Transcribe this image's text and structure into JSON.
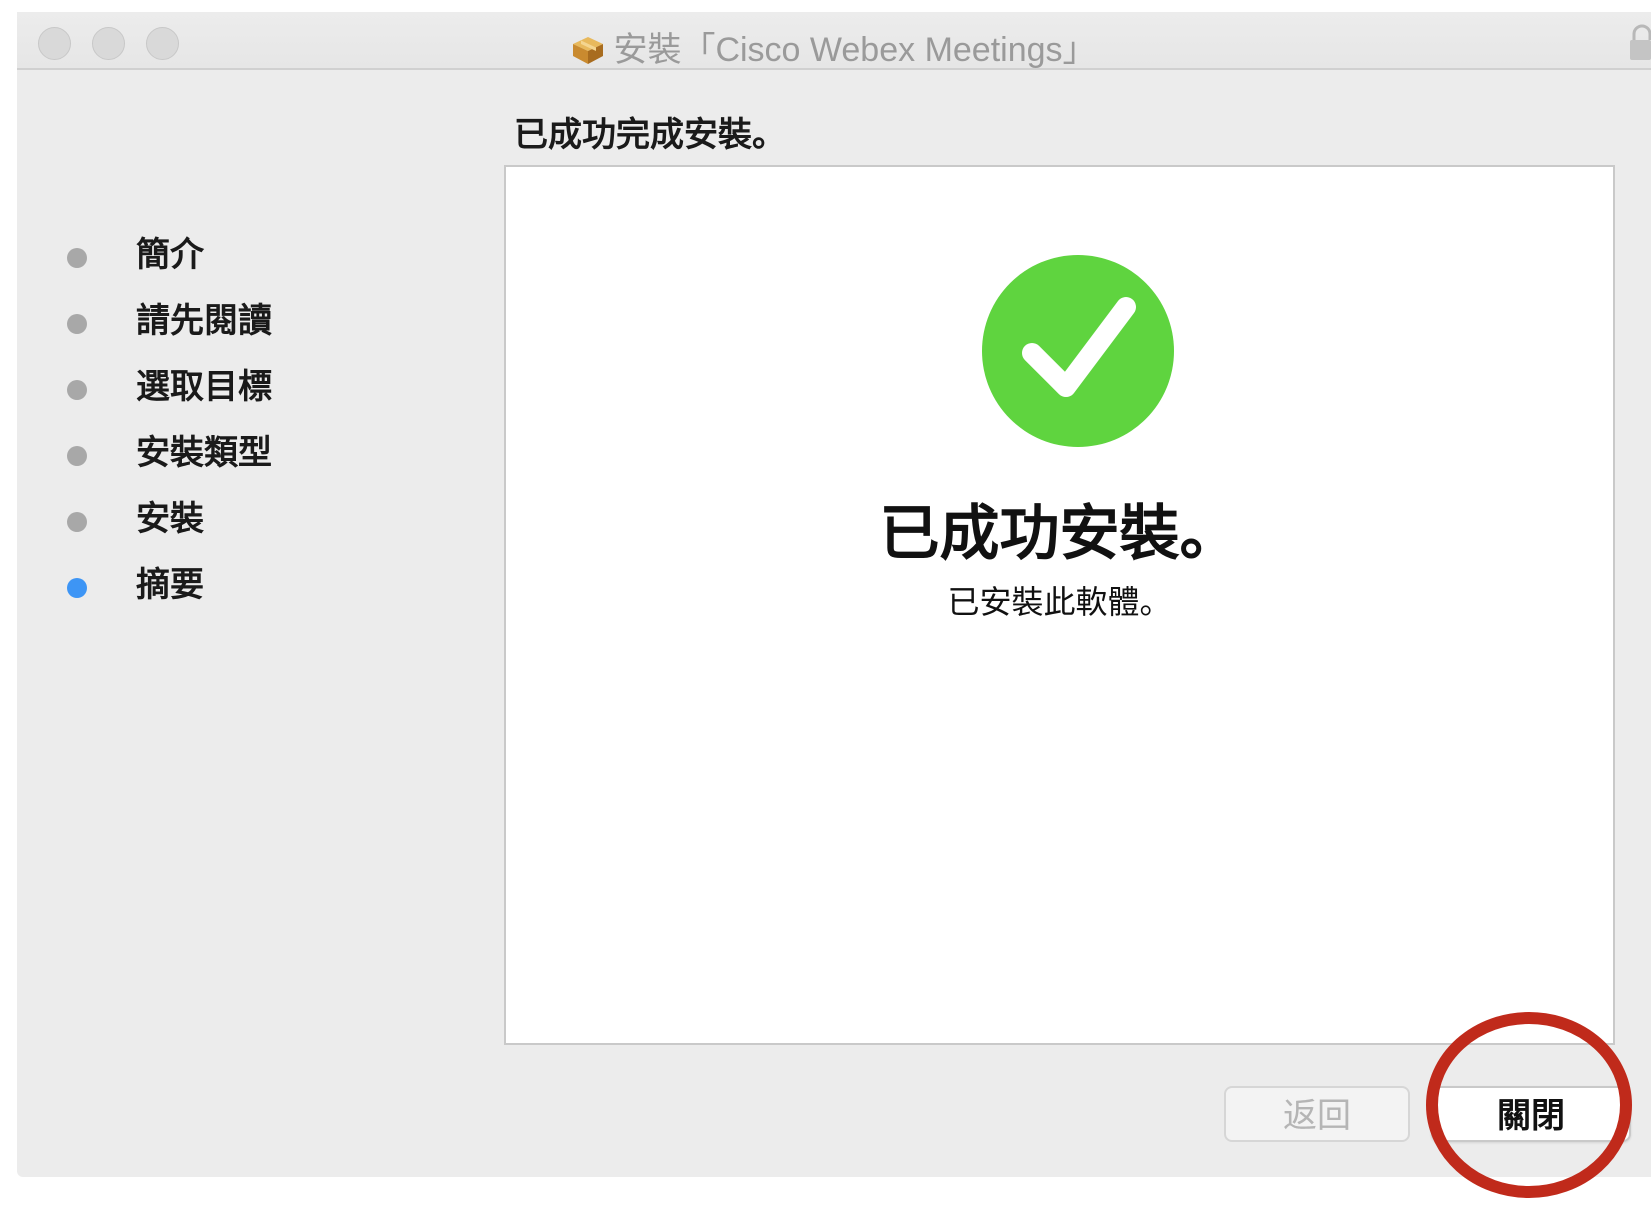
{
  "window": {
    "title": "安裝「Cisco Webex Meetings」",
    "title_icon": "package-icon"
  },
  "header": {
    "text": "已成功完成安裝。"
  },
  "sidebar": {
    "items": [
      {
        "label": "簡介",
        "state": "done"
      },
      {
        "label": "請先閱讀",
        "state": "done"
      },
      {
        "label": "選取目標",
        "state": "done"
      },
      {
        "label": "安裝類型",
        "state": "done"
      },
      {
        "label": "安裝",
        "state": "done"
      },
      {
        "label": "摘要",
        "state": "current"
      }
    ]
  },
  "main": {
    "status_icon": "checkmark-icon",
    "title": "已成功安裝。",
    "subtitle": "已安裝此軟體。"
  },
  "buttons": {
    "back_label": "返回",
    "close_label": "關閉"
  },
  "colors": {
    "success_green": "#5fd43f",
    "current_step_blue": "#3d95f5",
    "highlight_red": "#c02a1b"
  }
}
